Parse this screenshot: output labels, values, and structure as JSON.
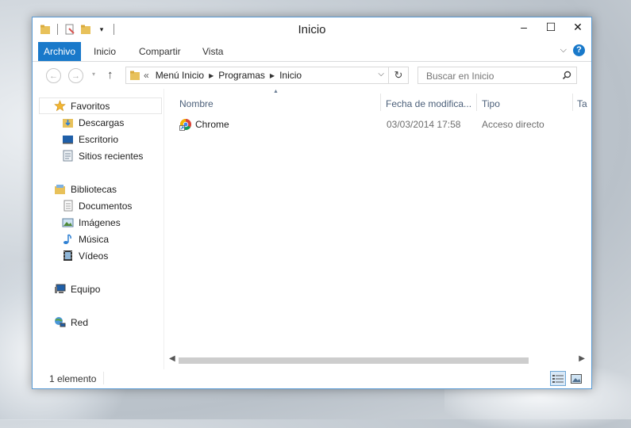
{
  "window": {
    "title": "Inicio",
    "controls": {
      "minimize": "‒",
      "maximize": "☐",
      "close": "✕"
    }
  },
  "ribbon": {
    "tabs": [
      "Archivo",
      "Inicio",
      "Compartir",
      "Vista"
    ],
    "active_tab": "Archivo",
    "accent_color": "#1979ca"
  },
  "navigation": {
    "breadcrumb_prefix": "«",
    "breadcrumb": [
      "Menú Inicio",
      "Programas",
      "Inicio"
    ],
    "search_placeholder": "Buscar en Inicio"
  },
  "sidebar": {
    "favorites": {
      "label": "Favoritos",
      "icon": "star-icon",
      "items": [
        {
          "label": "Descargas",
          "icon": "downloads-folder-icon"
        },
        {
          "label": "Escritorio",
          "icon": "desktop-icon"
        },
        {
          "label": "Sitios recientes",
          "icon": "recent-places-icon"
        }
      ]
    },
    "libraries": {
      "label": "Bibliotecas",
      "icon": "libraries-icon",
      "items": [
        {
          "label": "Documentos",
          "icon": "documents-icon"
        },
        {
          "label": "Imágenes",
          "icon": "pictures-icon"
        },
        {
          "label": "Música",
          "icon": "music-icon"
        },
        {
          "label": "Vídeos",
          "icon": "videos-icon"
        }
      ]
    },
    "computer": {
      "label": "Equipo",
      "icon": "computer-icon"
    },
    "network": {
      "label": "Red",
      "icon": "network-icon"
    }
  },
  "file_list": {
    "columns": [
      "Nombre",
      "Fecha de modifica...",
      "Tipo",
      "Ta"
    ],
    "rows": [
      {
        "name": "Chrome",
        "modified": "03/03/2014 17:58",
        "type": "Acceso directo",
        "icon": "chrome-shortcut-icon"
      }
    ]
  },
  "status": {
    "item_count": "1 elemento"
  }
}
